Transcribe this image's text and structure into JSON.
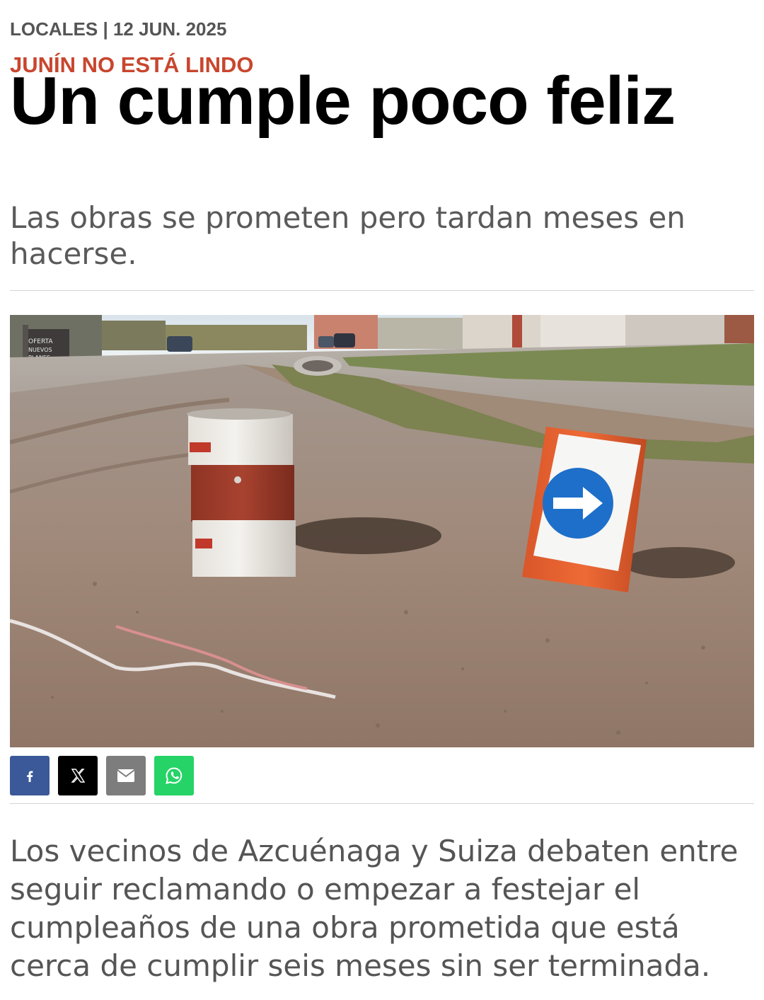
{
  "article": {
    "section": "LOCALES",
    "date": "12 JUN. 2025",
    "kicker": "JUNÍN NO ESTÁ LINDO",
    "title": "Un cumple poco feliz",
    "subtitle": "Las obras se prometen pero tardan meses en hacerse.",
    "lead": "Los vecinos de Azcuénaga y Suiza debaten entre seguir reclamando o empezar a festejar el cumpleaños de una obra prometida que está cerca de cumplir seis meses sin ser terminada."
  },
  "photo": {
    "sign_text": "OFERTA NUEVOS PLANES"
  },
  "share": {
    "buttons": [
      {
        "name": "facebook",
        "icon": "facebook-icon",
        "color": "#3b5998"
      },
      {
        "name": "x",
        "icon": "x-icon",
        "color": "#000000"
      },
      {
        "name": "email",
        "icon": "mail-icon",
        "color": "#7d7d7d"
      },
      {
        "name": "whatsapp",
        "icon": "whatsapp-icon",
        "color": "#25d366"
      }
    ]
  },
  "colors": {
    "kicker": "#c8462e",
    "meta": "#555555",
    "headline": "#000000",
    "subtitle": "#5a5a5a"
  }
}
